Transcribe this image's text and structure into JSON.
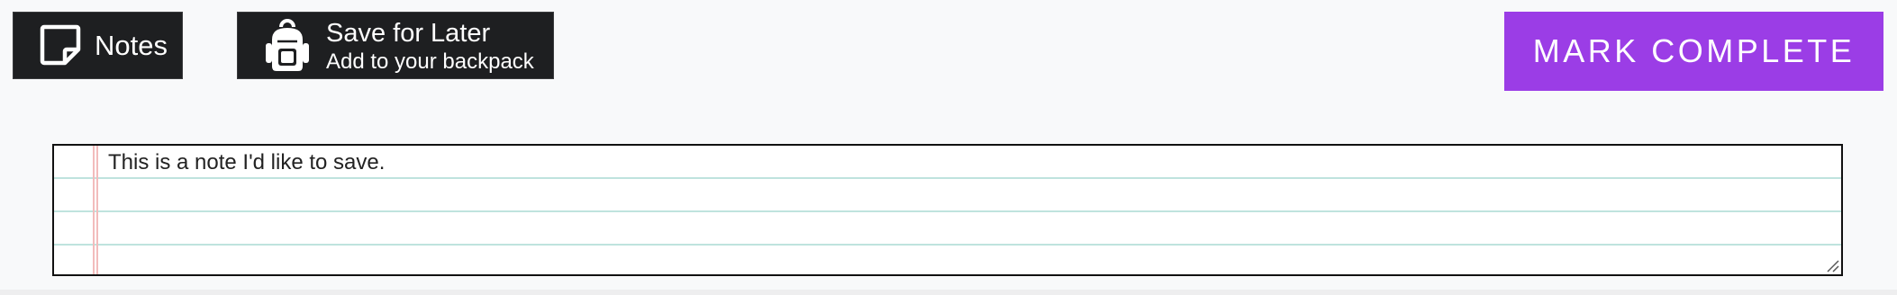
{
  "toolbar": {
    "notes": {
      "label": "Notes",
      "icon": "sticky-note-icon"
    },
    "save_for_later": {
      "title": "Save for Later",
      "subtitle": "Add to your backpack",
      "icon": "backpack-icon"
    },
    "mark_complete": {
      "label": "MARK COMPLETE",
      "color": "#9b3de6"
    }
  },
  "note": {
    "text": "This is a note I'd like to save."
  },
  "colors": {
    "dark_button": "#1e1f21",
    "page_background": "#f8f9fa",
    "ruled_line": "#bfe3de",
    "margin_line": "#f2bcbc"
  }
}
